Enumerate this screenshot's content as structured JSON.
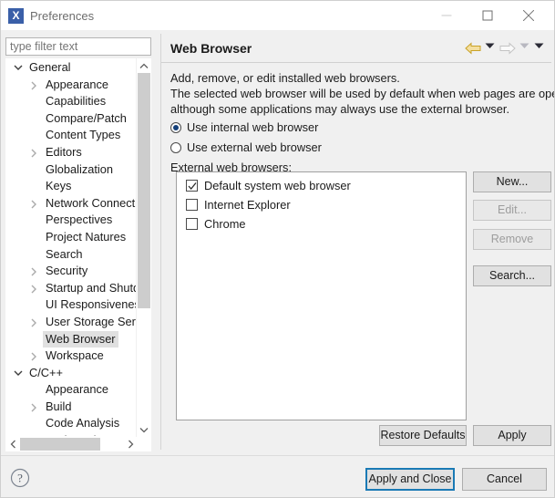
{
  "window": {
    "title": "Preferences",
    "icon": "eclipse-x-icon",
    "controls": {
      "minimize": "minimize-icon",
      "maximize": "maximize-icon",
      "close": "close-icon"
    }
  },
  "filter": {
    "placeholder": "type filter text",
    "value": ""
  },
  "tree": {
    "selected": "Web Browser",
    "items": [
      {
        "label": "General",
        "depth": 0,
        "expander": "chevron-down",
        "selected": false
      },
      {
        "label": "Appearance",
        "depth": 1,
        "expander": "chevron-right",
        "selected": false
      },
      {
        "label": "Capabilities",
        "depth": 1,
        "expander": "none",
        "selected": false
      },
      {
        "label": "Compare/Patch",
        "depth": 1,
        "expander": "none",
        "selected": false
      },
      {
        "label": "Content Types",
        "depth": 1,
        "expander": "none",
        "selected": false
      },
      {
        "label": "Editors",
        "depth": 1,
        "expander": "chevron-right",
        "selected": false
      },
      {
        "label": "Globalization",
        "depth": 1,
        "expander": "none",
        "selected": false
      },
      {
        "label": "Keys",
        "depth": 1,
        "expander": "none",
        "selected": false
      },
      {
        "label": "Network Connections",
        "depth": 1,
        "expander": "chevron-right",
        "selected": false
      },
      {
        "label": "Perspectives",
        "depth": 1,
        "expander": "none",
        "selected": false
      },
      {
        "label": "Project Natures",
        "depth": 1,
        "expander": "none",
        "selected": false
      },
      {
        "label": "Search",
        "depth": 1,
        "expander": "none",
        "selected": false
      },
      {
        "label": "Security",
        "depth": 1,
        "expander": "chevron-right",
        "selected": false
      },
      {
        "label": "Startup and Shutdown",
        "depth": 1,
        "expander": "chevron-right",
        "selected": false
      },
      {
        "label": "UI Responsiveness Monitoring",
        "depth": 1,
        "expander": "none",
        "selected": false
      },
      {
        "label": "User Storage Service",
        "depth": 1,
        "expander": "chevron-right",
        "selected": false
      },
      {
        "label": "Web Browser",
        "depth": 1,
        "expander": "none",
        "selected": true
      },
      {
        "label": "Workspace",
        "depth": 1,
        "expander": "chevron-right",
        "selected": false
      },
      {
        "label": "C/C++",
        "depth": 0,
        "expander": "chevron-down",
        "selected": false
      },
      {
        "label": "Appearance",
        "depth": 1,
        "expander": "none",
        "selected": false
      },
      {
        "label": "Build",
        "depth": 1,
        "expander": "chevron-right",
        "selected": false
      },
      {
        "label": "Code Analysis",
        "depth": 1,
        "expander": "none",
        "selected": false
      },
      {
        "label": "Code Style",
        "depth": 1,
        "expander": "chevron-right",
        "selected": false
      }
    ]
  },
  "page": {
    "title": "Web Browser",
    "nav": {
      "back": "back-arrow-icon",
      "back_menu": "chevron-down-icon",
      "forward": "forward-arrow-icon",
      "forward_menu": "chevron-down-icon",
      "view_menu": "chevron-down-icon"
    },
    "description": [
      "Add, remove, or edit installed web browsers.",
      "The selected web browser will be used by default when web pages are opened,",
      "although some applications may always use the external browser."
    ],
    "radios": [
      {
        "label": "Use internal web browser",
        "checked": true
      },
      {
        "label": "Use external web browser",
        "checked": false
      }
    ],
    "list_label": "External web browsers:",
    "browsers": [
      {
        "label": "Default system web browser",
        "checked": true
      },
      {
        "label": "Internet Explorer",
        "checked": false
      },
      {
        "label": "Chrome",
        "checked": false
      }
    ],
    "side_buttons": [
      {
        "label": "New...",
        "enabled": true
      },
      {
        "label": "Edit...",
        "enabled": false
      },
      {
        "label": "Remove",
        "enabled": false
      },
      {
        "label": "Search...",
        "enabled": true
      }
    ],
    "restore_defaults_label": "Restore Defaults",
    "apply_label": "Apply"
  },
  "footer": {
    "help_icon": "help-question-icon",
    "apply_and_close_label": "Apply and Close",
    "cancel_label": "Cancel"
  },
  "colors": {
    "accent_focus": "#1a7ab5",
    "radio_fill": "#15407a",
    "dialog_bg": "#f0f0f0",
    "titlebar_bg": "#ffffff",
    "selection_bg": "#e0e0e0",
    "nav_back_arrow": "#e6c86e"
  }
}
